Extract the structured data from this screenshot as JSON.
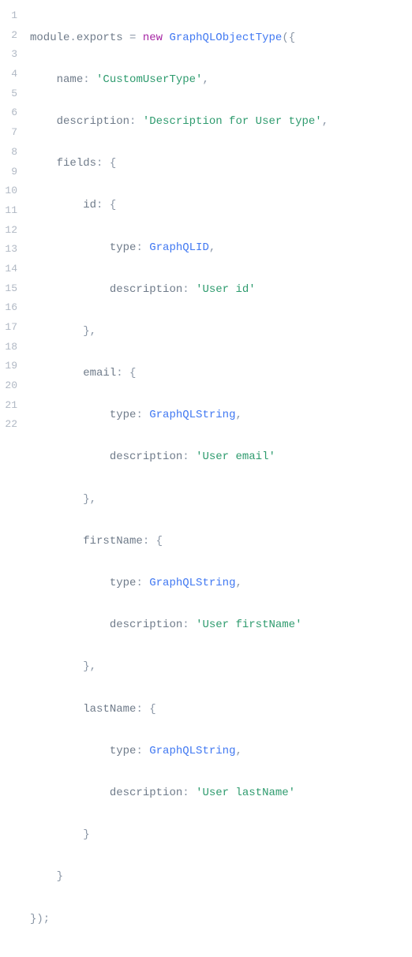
{
  "lineNumbers": [
    "1",
    "2",
    "3",
    "4",
    "5",
    "6",
    "7",
    "8",
    "9",
    "10",
    "11",
    "12",
    "13",
    "14",
    "15",
    "16",
    "17",
    "18",
    "19",
    "20",
    "21",
    "22"
  ],
  "code": {
    "module": "module",
    "exports": "exports",
    "eq": " = ",
    "new": "new",
    "sp": " ",
    "graphQLObjectType": "GraphQLObjectType",
    "lparenBrace": "({",
    "indent1": "    ",
    "indent2": "        ",
    "indent3": "            ",
    "nameKey": "name",
    "colon": ": ",
    "customUserType": "'CustomUserType'",
    "comma": ",",
    "descriptionKey": "description",
    "descForUserType": "'Description for User type'",
    "fieldsKey": "fields",
    "lbrace": "{",
    "idKey": "id",
    "typeKey": "type",
    "graphQLID": "GraphQLID",
    "userIdStr": "'User id'",
    "rbrace": "}",
    "rbraceComma": "},",
    "emailKey": "email",
    "graphQLString": "GraphQLString",
    "userEmailStr": "'User email'",
    "firstNameKey": "firstName",
    "userFirstNameStr": "'User firstName'",
    "lastNameKey": "lastName",
    "userLastNameStr": "'User lastName'",
    "closeAll": "});",
    "dot": "."
  }
}
